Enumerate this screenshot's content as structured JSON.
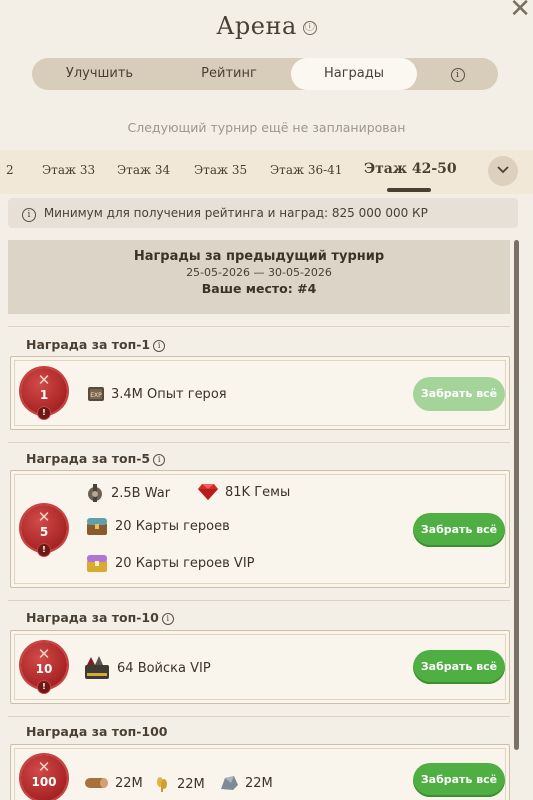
{
  "header": {
    "title": "Арена",
    "info_icon": "ⓘ",
    "close_icon": "✕"
  },
  "tabs": [
    {
      "label": "Улучшить"
    },
    {
      "label": "Рейтинг"
    },
    {
      "label": "Награды",
      "selected": true
    },
    {
      "label": "ⓘ"
    }
  ],
  "subtitle": "Следующий турнир ещё не запланирован",
  "floors": {
    "items": [
      "2",
      "Этаж 33",
      "Этаж 34",
      "Этаж 35",
      "Этаж 36-41",
      "Этаж 42-50"
    ],
    "selected": "Этаж 42-50",
    "dropdown_icon": "chevron-down"
  },
  "minimum": {
    "text": "Минимум для получения рейтинга и наград: 825 000 000 КР"
  },
  "previous": {
    "title": "Награды за предыдущий турнир",
    "dates": "25-05-2026 — 30-05-2026",
    "place": "Ваше место: #4"
  },
  "sections": [
    {
      "title": "Награда за топ-1",
      "rank": "1",
      "rewards": [
        {
          "icon": "exp-book-icon",
          "amount": "3.4M",
          "name": "Опыт героя"
        }
      ],
      "button": "Забрать всё",
      "button_state": "disabled"
    },
    {
      "title": "Награда за топ-5",
      "rank": "5",
      "rewards": [
        {
          "icon": "war-icon",
          "amount": "2.5B",
          "name": "War"
        },
        {
          "icon": "gem-icon",
          "amount": "81K",
          "name": "Гемы"
        },
        {
          "icon": "hero-chest-icon",
          "amount": "20",
          "name": "Карты героев"
        },
        {
          "icon": "vip-chest-icon",
          "amount": "20",
          "name": "Карты героев VIP"
        }
      ],
      "button": "Забрать всё",
      "button_state": "enabled"
    },
    {
      "title": "Награда за топ-10",
      "rank": "10",
      "rewards": [
        {
          "icon": "troops-icon",
          "amount": "64",
          "name": "Войска VIP"
        }
      ],
      "button": "Забрать всё",
      "button_state": "enabled"
    },
    {
      "title": "Награда за топ-100",
      "rank": "100",
      "rewards": [
        {
          "icon": "wood-icon",
          "amount": "22M"
        },
        {
          "icon": "wheat-icon",
          "amount": "22M"
        },
        {
          "icon": "stone-icon",
          "amount": "22M"
        }
      ],
      "button": "Забрать всё",
      "button_state": "enabled"
    }
  ],
  "badge_mark": "!",
  "colors": {
    "accent_green": "#4faf43",
    "disabled_green": "#a5d49a",
    "seal_red": "#b02a2a",
    "background": "#f4efe6"
  }
}
